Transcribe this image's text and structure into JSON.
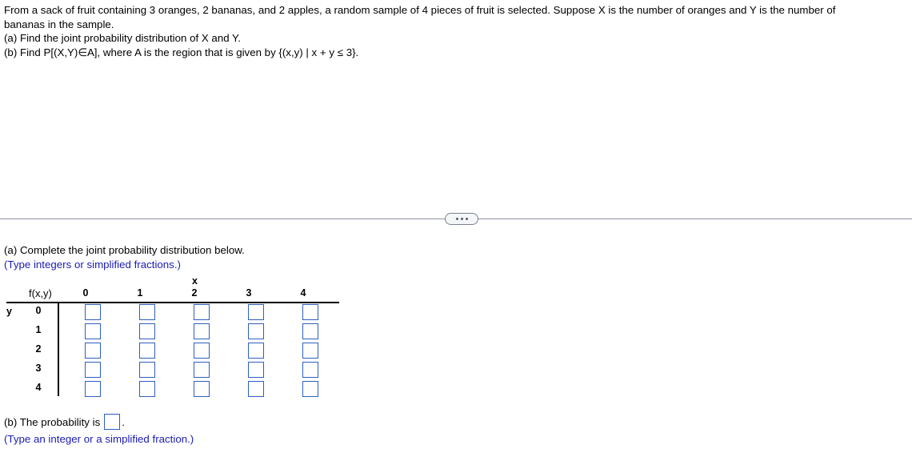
{
  "problem": {
    "lines": [
      "From a sack of fruit containing 3 oranges, 2 bananas, and 2 apples, a random sample of 4 pieces of fruit is selected. Suppose X is the number of oranges and Y is the number of",
      "bananas in the sample.",
      "(a) Find the joint probability distribution of X and Y.",
      "(b) Find P[(X,Y)∈A], where A is the region that is given by {(x,y) | x + y ≤ 3}."
    ]
  },
  "divider": {
    "ellipsis_label": "..."
  },
  "part_a": {
    "instruction": "(a) Complete the joint probability distribution below.",
    "type_hint": "(Type integers or simplified fractions.)"
  },
  "table": {
    "corner_label": "f(x,y)",
    "x_axis_label": "x",
    "y_axis_label": "y",
    "column_headers": [
      "0",
      "1",
      "2",
      "3",
      "4"
    ],
    "row_headers": [
      "0",
      "1",
      "2",
      "3",
      "4"
    ],
    "cell_values": [
      [
        "",
        "",
        "",
        "",
        ""
      ],
      [
        "",
        "",
        "",
        "",
        ""
      ],
      [
        "",
        "",
        "",
        "",
        ""
      ],
      [
        "",
        "",
        "",
        "",
        ""
      ],
      [
        "",
        "",
        "",
        "",
        ""
      ]
    ]
  },
  "part_b": {
    "prefix": "(b) The probability is",
    "value": "",
    "suffix": ".",
    "type_hint": "(Type an integer or a simplified fraction.)"
  },
  "colors": {
    "input_border": "#2f5fbf",
    "hint_text": "#1b1bb3",
    "divider": "#8d93a1",
    "rule": "#000000"
  }
}
